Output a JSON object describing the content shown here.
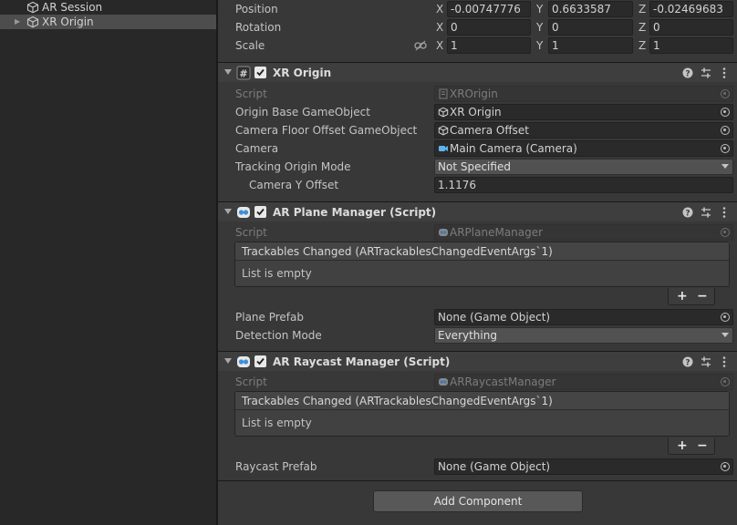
{
  "hierarchy": {
    "items": [
      {
        "label": "AR Session"
      },
      {
        "label": "XR Origin"
      }
    ]
  },
  "transform": {
    "position": {
      "label": "Position",
      "x": "-0.00747776",
      "y": "0.6633587",
      "z": "-0.02469683"
    },
    "rotation": {
      "label": "Rotation",
      "x": "0",
      "y": "0",
      "z": "0"
    },
    "scale": {
      "label": "Scale",
      "x": "1",
      "y": "1",
      "z": "1"
    },
    "axes": {
      "x": "X",
      "y": "Y",
      "z": "Z"
    }
  },
  "xr_origin": {
    "title": "XR Origin",
    "script": {
      "label": "Script",
      "value": "XROrigin"
    },
    "origin_base": {
      "label": "Origin Base GameObject",
      "value": "XR Origin"
    },
    "camera_floor": {
      "label": "Camera Floor Offset GameObject",
      "value": "Camera Offset"
    },
    "camera": {
      "label": "Camera",
      "value": "Main Camera (Camera)"
    },
    "tracking_mode": {
      "label": "Tracking Origin Mode",
      "value": "Not Specified"
    },
    "camera_y": {
      "label": "Camera Y Offset",
      "value": "1.1176"
    }
  },
  "plane_manager": {
    "title": "AR Plane Manager (Script)",
    "script": {
      "label": "Script",
      "value": "ARPlaneManager"
    },
    "event_title": "Trackables Changed (ARTrackablesChangedEventArgs`1)",
    "event_body": "List is empty",
    "plane_prefab": {
      "label": "Plane Prefab",
      "value": "None (Game Object)"
    },
    "detection_mode": {
      "label": "Detection Mode",
      "value": "Everything"
    }
  },
  "raycast_manager": {
    "title": "AR Raycast Manager (Script)",
    "script": {
      "label": "Script",
      "value": "ARRaycastManager"
    },
    "event_title": "Trackables Changed (ARTrackablesChangedEventArgs`1)",
    "event_body": "List is empty",
    "raycast_prefab": {
      "label": "Raycast Prefab",
      "value": "None (Game Object)"
    }
  },
  "buttons": {
    "plus": "+",
    "minus": "−",
    "add_component": "Add Component"
  },
  "colors": {
    "panel": "#383838",
    "hierarchy_bg": "#282828",
    "field_bg": "#2a2a2a",
    "header_bg": "#3e3e3e",
    "selected": "#4d4d4d",
    "camera_icon": "#5fb4f0"
  }
}
